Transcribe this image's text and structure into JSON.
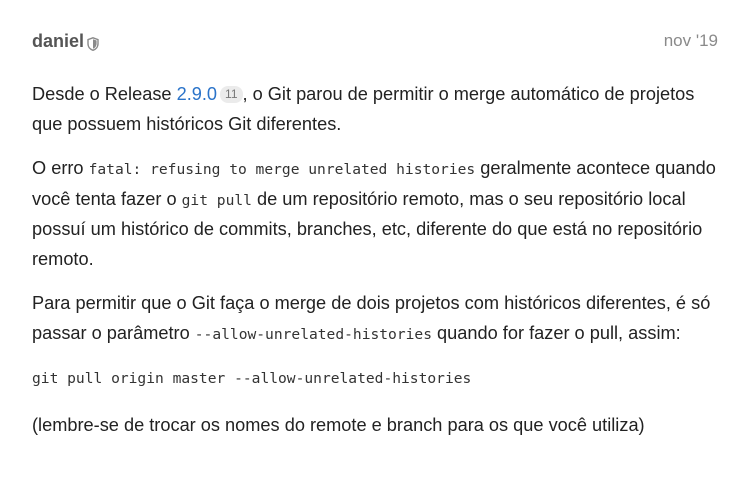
{
  "post": {
    "author": "daniel",
    "author_badge_icon": "shield-icon",
    "date": "nov '19",
    "p1": {
      "before_link": "Desde o Release ",
      "link_text": "2.9.0",
      "link_clicks": "11",
      "after_link": ", o Git parou de permitir o merge automático de projetos que possuem históricos Git diferentes."
    },
    "p2": {
      "t1": "O erro ",
      "code1": "fatal: refusing to merge unrelated histories",
      "t2": " geralmente acontece quando você tenta fazer o ",
      "code2": "git pull",
      "t3": " de um repositório remoto, mas o seu repositório local possuí um histórico de commits, branches, etc, diferente do que está no repositório remoto."
    },
    "p3": {
      "t1": "Para permitir que o Git faça o merge de dois projetos com históricos diferentes, é só passar o parâmetro ",
      "code1": "--allow-unrelated-histories",
      "t2": " quando for fazer o pull, assim:"
    },
    "code_block": "git pull origin master --allow-unrelated-histories",
    "p4": "(lembre-se de trocar os nomes do remote e branch para os que você utiliza)"
  },
  "colors": {
    "link": "#2a73c9",
    "text": "#222222",
    "muted": "#8a8a8a"
  }
}
